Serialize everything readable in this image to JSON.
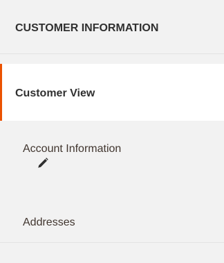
{
  "panel": {
    "title": "CUSTOMER INFORMATION"
  },
  "nav": {
    "items": [
      {
        "label": "Customer View",
        "active": true
      },
      {
        "label": "Account Information",
        "active": false,
        "icon": "pencil-icon"
      },
      {
        "label": "Addresses",
        "active": false
      }
    ]
  },
  "colors": {
    "accent": "#eb5202",
    "panel_background": "#f2f2f2",
    "active_background": "#ffffff",
    "text": "#303030"
  }
}
